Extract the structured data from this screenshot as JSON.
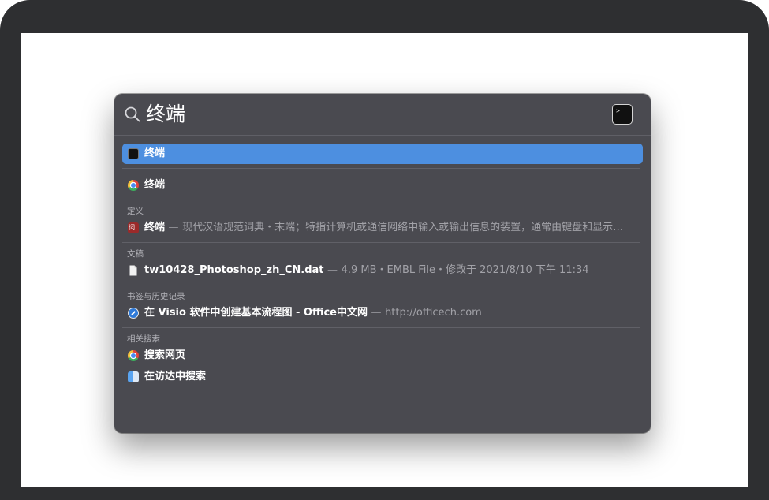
{
  "search": {
    "query": "终端"
  },
  "top_hit": {
    "label": "终端",
    "icon": "terminal-icon"
  },
  "results": [
    {
      "label": "终端",
      "icon": "chrome-icon"
    }
  ],
  "sections": {
    "definition": {
      "title": "定义",
      "item": {
        "label": "终端",
        "detail": "现代汉语规范词典・末端；特指计算机或通信网络中输入或输出信息的装置，通常由键盘和显示…",
        "icon": "dictionary-icon"
      }
    },
    "documents": {
      "title": "文稿",
      "item": {
        "label": "tw10428_Photoshop_zh_CN.dat",
        "detail": "4.9 MB・EMBL File・修改于 2021/8/10 下午 11:34",
        "icon": "document-icon"
      }
    },
    "bookmarks": {
      "title": "书签与历史记录",
      "item": {
        "label": "在 Visio 软件中创建基本流程图 - Office中文网",
        "detail": "http://officech.com",
        "icon": "safari-icon"
      }
    },
    "related": {
      "title": "相关搜索",
      "items": [
        {
          "label": "搜索网页",
          "icon": "chrome-icon"
        },
        {
          "label": "在访达中搜索",
          "icon": "finder-icon"
        }
      ]
    }
  },
  "colors": {
    "selection": "#4d8fe0",
    "panel": "#4a4a50",
    "bezel": "#2e2f31"
  },
  "dash": "—"
}
